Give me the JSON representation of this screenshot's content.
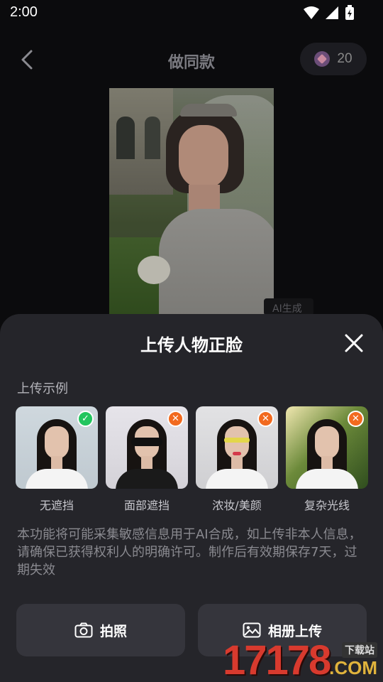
{
  "status_bar": {
    "time": "2:00"
  },
  "header": {
    "title": "做同款",
    "credits": "20"
  },
  "preview": {
    "ai_tag": "AI生成"
  },
  "sheet": {
    "title": "上传人物正脸",
    "section_label": "上传示例",
    "examples": [
      {
        "label": "无遮挡",
        "status": "ok"
      },
      {
        "label": "面部遮挡",
        "status": "no"
      },
      {
        "label": "浓妆/美颜",
        "status": "no"
      },
      {
        "label": "复杂光线",
        "status": "no"
      }
    ],
    "notice": "本功能将可能采集敏感信息用于AI合成，如上传非本人信息，请确保已获得权利人的明确许可。制作后有效期保存7天，过期失效",
    "buttons": {
      "camera": "拍照",
      "album": "相册上传"
    }
  },
  "watermark": {
    "number": "17178",
    "domain": ".COM",
    "tag": "下载站"
  },
  "colors": {
    "ok": "#22c55e",
    "no": "#f26a1f",
    "sheet_bg": "#25252a",
    "button_bg": "#35353c"
  }
}
